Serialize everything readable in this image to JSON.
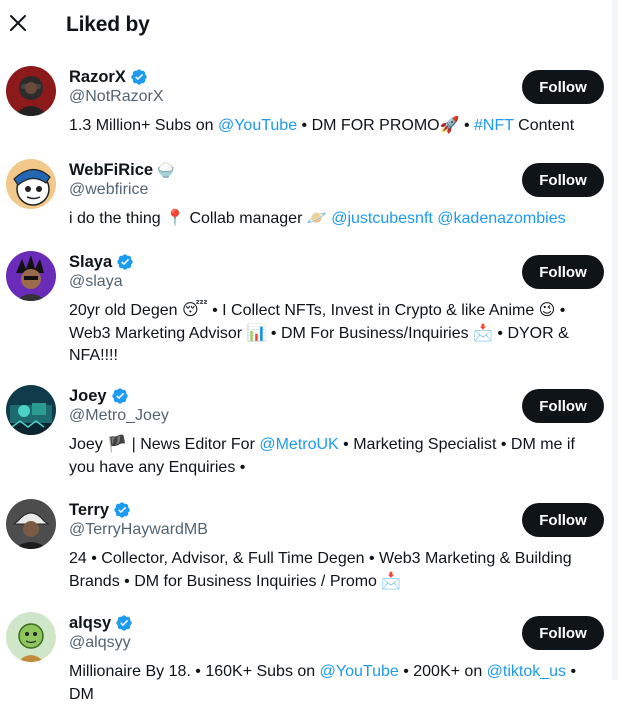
{
  "header": {
    "title": "Liked by",
    "close_icon": "close-icon"
  },
  "follow_label": "Follow",
  "colors": {
    "link": "#1d9bf0",
    "verified": "#1d9bf0",
    "button_bg": "#0f1419",
    "secondary_text": "#536471"
  },
  "users": [
    {
      "name": "RazorX",
      "verified": true,
      "name_emoji": "",
      "handle": "@NotRazorX",
      "bio": [
        {
          "t": "1.3 Million+ Subs on "
        },
        {
          "t": "@YouTube",
          "link": true
        },
        {
          "t": " • DM FOR PROMO🚀 • "
        },
        {
          "t": "#NFT",
          "link": true
        },
        {
          "t": " Content"
        }
      ]
    },
    {
      "name": "WebFiRice",
      "verified": false,
      "name_emoji": "🍚",
      "handle": "@webfirice",
      "bio": [
        {
          "t": "i do the thing 📍 Collab manager 🪐 "
        },
        {
          "t": "@justcubesnft",
          "link": true
        },
        {
          "t": " "
        },
        {
          "t": "@kadenazombies",
          "link": true
        }
      ]
    },
    {
      "name": "Slaya",
      "verified": true,
      "name_emoji": "",
      "handle": "@slaya",
      "bio": [
        {
          "t": "20yr old Degen 😴 • I Collect NFTs, Invest in Crypto & like Anime 😉 • Web3 Marketing Advisor 📊 • DM For Business/Inquiries 📩 • DYOR & NFA!!!!"
        }
      ]
    },
    {
      "name": "Joey",
      "verified": true,
      "name_emoji": "",
      "handle": "@Metro_Joey",
      "bio": [
        {
          "t": "Joey 🏴 | News Editor For "
        },
        {
          "t": "@MetroUK",
          "link": true
        },
        {
          "t": " • Marketing Specialist • DM me if you have any Enquiries •"
        }
      ]
    },
    {
      "name": "Terry",
      "verified": true,
      "name_emoji": "",
      "handle": "@TerryHaywardMB",
      "bio": [
        {
          "t": "24 • Collector, Advisor, & Full Time Degen • Web3 Marketing & Building Brands • DM for Business Inquiries / Promo 📩"
        }
      ]
    },
    {
      "name": "alqsy",
      "verified": true,
      "name_emoji": "",
      "handle": "@alqsyy",
      "bio": [
        {
          "t": "Millionaire By 18. • 160K+ Subs on "
        },
        {
          "t": "@YouTube",
          "link": true
        },
        {
          "t": " • 200K+ on "
        },
        {
          "t": "@tiktok_us",
          "link": true
        },
        {
          "t": " • DM"
        }
      ]
    }
  ]
}
